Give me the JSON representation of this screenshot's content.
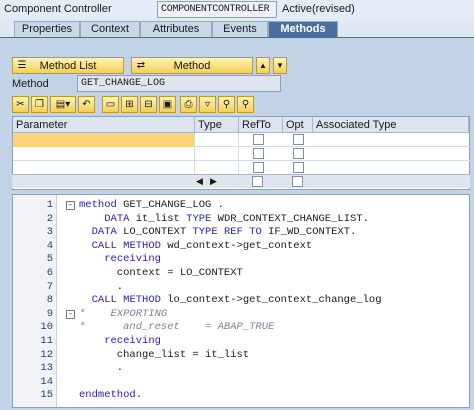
{
  "header": {
    "label": "Component Controller",
    "controller_name": "COMPONENTCONTROLLER",
    "status": "Active(revised)"
  },
  "tabs": [
    "Properties",
    "Context",
    "Attributes",
    "Events",
    "Methods"
  ],
  "active_tab": "Methods",
  "buttons": {
    "method_list": "Method List",
    "method": "Method"
  },
  "method_field": {
    "label": "Method",
    "value": "GET_CHANGE_LOG"
  },
  "toolbar_icons": [
    "cut-icon",
    "copy-icon",
    "paste-icon",
    "undo-icon",
    "new-line-icon",
    "insert-line-icon",
    "delete-line-icon",
    "detail-icon",
    "print-icon",
    "filter-icon",
    "find-icon",
    "find-next-icon"
  ],
  "param_table": {
    "columns": [
      "Parameter",
      "Type",
      "RefTo",
      "Opt",
      "Associated Type"
    ],
    "rows": [
      "",
      "",
      "",
      ""
    ]
  },
  "code_lines": [
    {
      "n": "1",
      "fold": "-",
      "text": "method GET_CHANGE_LOG ."
    },
    {
      "n": "2",
      "fold": "",
      "text": "    DATA it_list TYPE WDR_CONTEXT_CHANGE_LIST."
    },
    {
      "n": "3",
      "fold": "",
      "text": "  DATA LO_CONTEXT TYPE REF TO IF_WD_CONTEXT."
    },
    {
      "n": "4",
      "fold": "",
      "text": "  CALL METHOD wd_context->get_context"
    },
    {
      "n": "5",
      "fold": "",
      "text": "    receiving"
    },
    {
      "n": "6",
      "fold": "",
      "text": "      context = LO_CONTEXT"
    },
    {
      "n": "7",
      "fold": "",
      "text": "      ."
    },
    {
      "n": "8",
      "fold": "",
      "text": "  CALL METHOD lo_context->get_context_change_log"
    },
    {
      "n": "9",
      "fold": "-",
      "text": "*    EXPORTING"
    },
    {
      "n": "10",
      "fold": "",
      "text": "*      and_reset    = ABAP_TRUE"
    },
    {
      "n": "11",
      "fold": "",
      "text": "    receiving"
    },
    {
      "n": "12",
      "fold": "",
      "text": "      change_list = it_list"
    },
    {
      "n": "13",
      "fold": "",
      "text": "      ."
    },
    {
      "n": "14",
      "fold": "",
      "text": ""
    },
    {
      "n": "15",
      "fold": "",
      "text": "endmethod."
    }
  ],
  "colors": {
    "accent": "#4a6f9e",
    "button": "#f3cf55",
    "keyword": "#1f24c9"
  }
}
